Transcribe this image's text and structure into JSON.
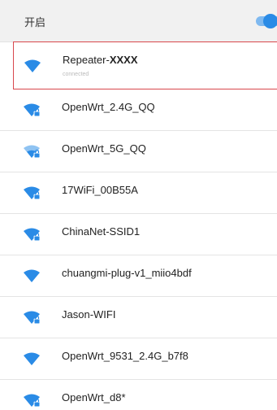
{
  "header": {
    "label": "开启",
    "toggle_on": true
  },
  "colors": {
    "wifi": "#2a8be6",
    "wifi_weak": "#8fc3f2",
    "selected_border": "#d8484d",
    "toggle": "#2a8be6"
  },
  "networks": [
    {
      "ssid_prefix": "Repeater-",
      "ssid_bold": "XXXX",
      "status": "connected",
      "locked": false,
      "icon": "wifi-icon"
    },
    {
      "ssid": "OpenWrt_2.4G_QQ",
      "locked": true,
      "icon": "wifi-lock-icon"
    },
    {
      "ssid": "OpenWrt_5G_QQ",
      "locked": true,
      "icon": "wifi-lock-weak-icon"
    },
    {
      "ssid": "17WiFi_00B55A",
      "locked": true,
      "icon": "wifi-lock-icon"
    },
    {
      "ssid": "ChinaNet-SSID1",
      "locked": true,
      "icon": "wifi-lock-icon"
    },
    {
      "ssid": "chuangmi-plug-v1_miio4bdf",
      "locked": false,
      "icon": "wifi-icon"
    },
    {
      "ssid": "Jason-WIFI",
      "locked": true,
      "icon": "wifi-lock-icon"
    },
    {
      "ssid": "OpenWrt_9531_2.4G_b7f8",
      "locked": false,
      "icon": "wifi-icon"
    },
    {
      "ssid": "OpenWrt_d8*",
      "locked": true,
      "icon": "wifi-lock-icon"
    }
  ]
}
